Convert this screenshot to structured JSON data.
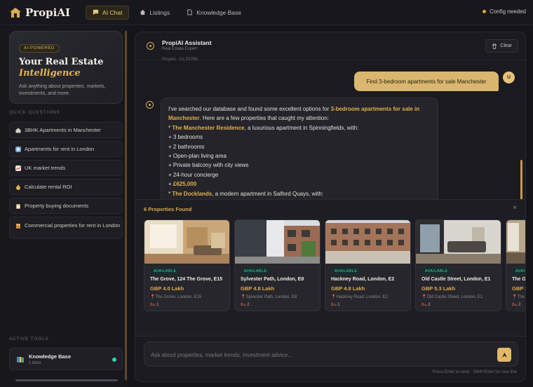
{
  "app": {
    "name": "PropiAI"
  },
  "nav": {
    "items": [
      {
        "label": "AI Chat",
        "icon": "chat-icon",
        "active": true
      },
      {
        "label": "Listings",
        "icon": "home-icon",
        "active": false
      },
      {
        "label": "Knowledge Base",
        "icon": "document-icon",
        "active": false
      }
    ]
  },
  "status": {
    "text": "Config needed",
    "color": "#e0a53a"
  },
  "hero": {
    "badge": "AI-POWERED",
    "title_line1": "Your Real Estate",
    "title_line2": "Intelligence",
    "description": "Ask anything about properties, markets, investments, and more."
  },
  "quick_questions": {
    "label": "QUICK QUESTIONS",
    "items": [
      {
        "label": "3BHK Apartments in Manchester",
        "icon": "building-icon"
      },
      {
        "label": "Apartments for rent in London",
        "icon": "key-icon"
      },
      {
        "label": "UK market trends",
        "icon": "chart-icon"
      },
      {
        "label": "Calculate rental ROI",
        "icon": "money-bag-icon"
      },
      {
        "label": "Property buying documents",
        "icon": "clipboard-icon"
      },
      {
        "label": "Commercial properties for rent in London",
        "icon": "office-icon"
      }
    ]
  },
  "active_tools": {
    "label": "ACTIVE TOOLS",
    "items": [
      {
        "name": "Knowledge Base",
        "sub": "1 docs",
        "icon": "books-icon"
      }
    ]
  },
  "chat": {
    "title": "PropiAI Assistant",
    "subtitle": "Real Estate Expert",
    "clear_label": "Clear",
    "prev_time": "PropiAI · 01:20 PM",
    "user_message": "Find 3-bedroom apartments for sale Manchester",
    "user_initial": "U",
    "bot_message": {
      "intro_pre": "I've searched our database and found some excellent options for ",
      "intro_hl": "3-bedroom apartments for sale in Manchester",
      "intro_post": ". Here are a few properties that caught my attention:",
      "item1_name": "The Manchester Residence",
      "item1_desc": ", a luxurious apartment in Spinningfields, with:",
      "item1_lines": [
        "+ 3 bedrooms",
        "+ 2 bathrooms",
        "+ Open-plan living area",
        "+ Private balcony with city views",
        "+ 24-hour concierge"
      ],
      "item1_price": "£625,000",
      "item2_name": "The Docklands",
      "item2_desc": ", a modern apartment in Salford Quays, with:"
    }
  },
  "properties": {
    "title": "6 Properties Found",
    "close": "×",
    "available_label": "AVAILABLE",
    "cards": [
      {
        "title": "The Grove, 124 The Grove, E15",
        "price": "GBP 4.0 Lakh",
        "address": "The Grove, London, E15",
        "beds": "1"
      },
      {
        "title": "Sylvester Path, London, E8",
        "price": "GBP 4.8 Lakh",
        "address": "Sylvester Path, London, E8",
        "beds": "2"
      },
      {
        "title": "Hackney Road, London, E2",
        "price": "GBP 4.8 Lakh",
        "address": "Hackney Road, London, E2",
        "beds": "1"
      },
      {
        "title": "Old Castle Street, London, E1",
        "price": "GBP 5.3 Lakh",
        "address": "Old Castle Street, London, E1",
        "beds": "2"
      },
      {
        "title": "The G",
        "price": "GBP 5",
        "address": "The",
        "beds": "2"
      }
    ]
  },
  "input": {
    "placeholder": "Ask about properties, market trends, investment advice...",
    "hint": "Press Enter to send · Shift+Enter for new line"
  }
}
